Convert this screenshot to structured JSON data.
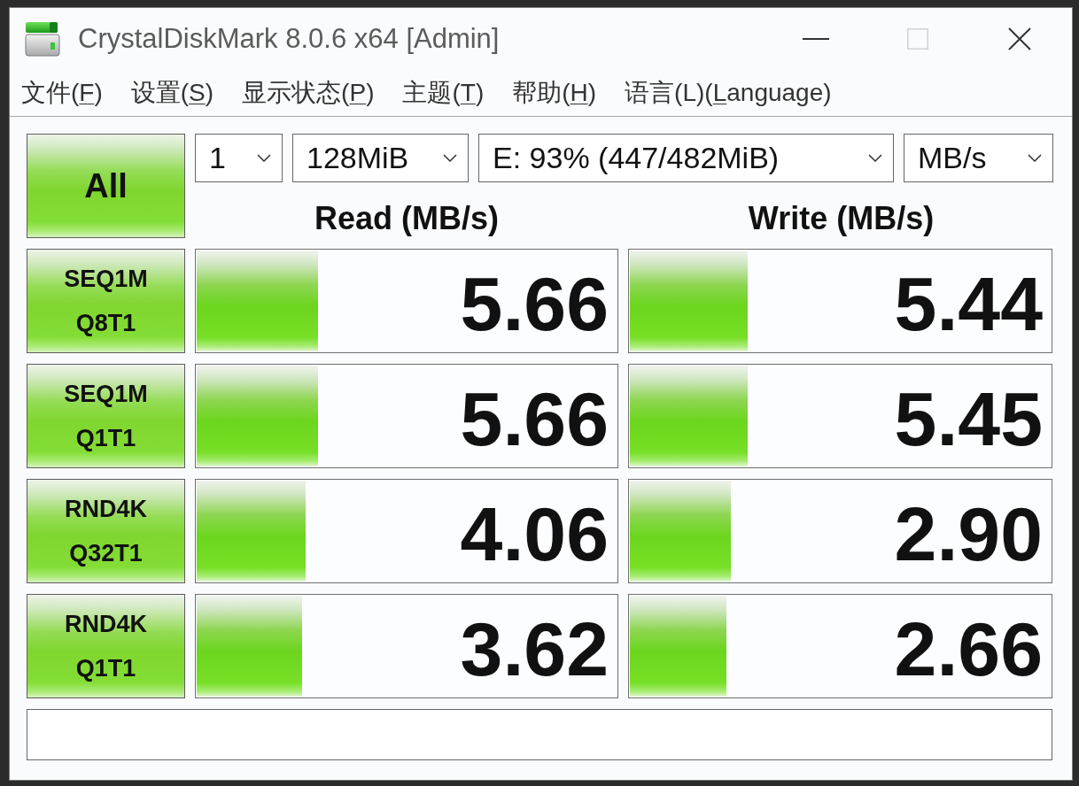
{
  "window": {
    "title": "CrystalDiskMark 8.0.6 x64 [Admin]",
    "controls": [
      {
        "kind": "minimize",
        "disabled": false
      },
      {
        "kind": "maximize",
        "disabled": true
      },
      {
        "kind": "close",
        "disabled": false
      }
    ]
  },
  "menu": [
    {
      "before": "文件(",
      "mnemonic": "F",
      "after": ")"
    },
    {
      "before": "设置(",
      "mnemonic": "S",
      "after": ")"
    },
    {
      "before": "显示状态(",
      "mnemonic": "P",
      "after": ")"
    },
    {
      "before": "主题(",
      "mnemonic": "T",
      "after": ")"
    },
    {
      "before": "帮助(",
      "mnemonic": "H",
      "after": ")"
    },
    {
      "before": "语言(L)(",
      "mnemonic": "L",
      "after": "anguage)"
    }
  ],
  "all_button": "All",
  "options": [
    {
      "value": "1"
    },
    {
      "value": "128MiB"
    },
    {
      "value": "E: 93% (447/482MiB)"
    },
    {
      "value": "MB/s"
    }
  ],
  "columns": [
    "Read (MB/s)",
    "Write (MB/s)"
  ],
  "tests": [
    {
      "label": [
        "SEQ1M",
        "Q8T1"
      ],
      "read": {
        "value": "5.66",
        "level": 0.29
      },
      "write": {
        "value": "5.44",
        "level": 0.28
      }
    },
    {
      "label": [
        "SEQ1M",
        "Q1T1"
      ],
      "read": {
        "value": "5.66",
        "level": 0.29
      },
      "write": {
        "value": "5.45",
        "level": 0.28
      }
    },
    {
      "label": [
        "RND4K",
        "Q32T1"
      ],
      "read": {
        "value": "4.06",
        "level": 0.26
      },
      "write": {
        "value": "2.90",
        "level": 0.24
      }
    },
    {
      "label": [
        "RND4K",
        "Q1T1"
      ],
      "read": {
        "value": "3.62",
        "level": 0.25
      },
      "write": {
        "value": "2.66",
        "level": 0.23
      }
    }
  ]
}
